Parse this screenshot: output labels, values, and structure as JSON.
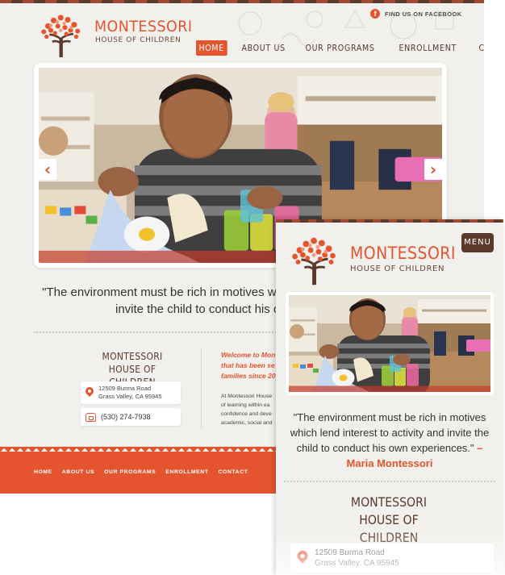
{
  "brand": {
    "title": "MONTESSORI",
    "subtitle": "HOUSE OF CHILDREN",
    "accent": "#e4552f",
    "brown": "#5b3a2c"
  },
  "header": {
    "facebook_label": "FIND US ON FACEBOOK",
    "facebook_icon": "f"
  },
  "nav": {
    "items": [
      "HOME",
      "ABOUT US",
      "OUR PROGRAMS",
      "ENROLLMENT",
      "CONTACT"
    ],
    "active": "HOME"
  },
  "slider": {
    "prev_glyph": "‹",
    "next_glyph": "›"
  },
  "quote": {
    "desktop_text": "\"The environment must be rich in motives which lend interest to activity and invite the child to conduct his own experiences.\"",
    "mobile_text": "\"The environment must be rich in motives which lend interest to activity and invite the child to conduct his own experiences.\"",
    "author": "– Maria Montessori"
  },
  "contact": {
    "name_line1": "MONTESSORI",
    "name_line2": "HOUSE OF CHILDREN",
    "address_line1": "12509 Burma Road",
    "address_line2": "Grass Valley, CA 95945",
    "phone": "(530) 274-7938"
  },
  "welcome": {
    "line1": "Welcome to Mon",
    "line2": "that has been se",
    "line3": "families since 20",
    "body_line1": "At Montessori House",
    "body_line2": "of learning within ea",
    "body_line3": "confidence and deve",
    "body_line4": "academic, social and"
  },
  "footer": {
    "links": [
      "HOME",
      "ABOUT US",
      "OUR PROGRAMS",
      "ENROLLMENT",
      "CONTACT"
    ]
  },
  "mobile": {
    "menu_label": "MENU"
  }
}
